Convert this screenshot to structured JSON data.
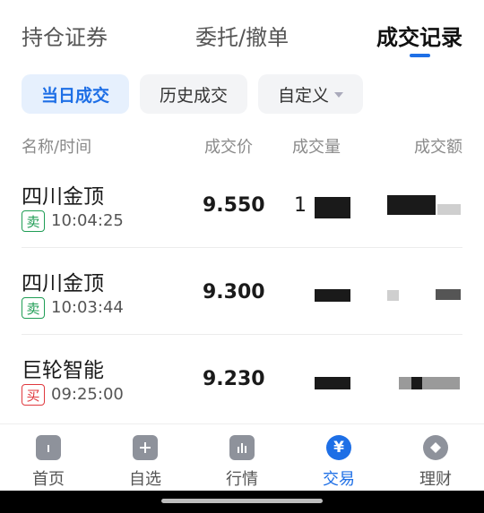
{
  "tabs": [
    {
      "label": "持仓证券"
    },
    {
      "label": "委托/撤单"
    },
    {
      "label": "成交记录"
    }
  ],
  "filters": {
    "today": "当日成交",
    "history": "历史成交",
    "custom": "自定义"
  },
  "table": {
    "headers": {
      "name_time": "名称/时间",
      "price": "成交价",
      "qty": "成交量",
      "amount": "成交额"
    },
    "rows": [
      {
        "name": "四川金顶",
        "side": "卖",
        "time": "10:04:25",
        "price": "9.550",
        "qty_visible": "1"
      },
      {
        "name": "四川金顶",
        "side": "卖",
        "time": "10:03:44",
        "price": "9.300",
        "qty_visible": ""
      },
      {
        "name": "巨轮智能",
        "side": "买",
        "time": "09:25:00",
        "price": "9.230",
        "qty_visible": ""
      }
    ]
  },
  "nav": [
    {
      "label": "首页",
      "icon": "home-icon"
    },
    {
      "label": "自选",
      "icon": "plus-icon"
    },
    {
      "label": "行情",
      "icon": "chart-icon"
    },
    {
      "label": "交易",
      "icon": "yen-icon"
    },
    {
      "label": "理财",
      "icon": "diamond-icon"
    }
  ],
  "colors": {
    "accent": "#1e6fe6",
    "sell": "#1f9d55",
    "buy": "#e0393e"
  }
}
